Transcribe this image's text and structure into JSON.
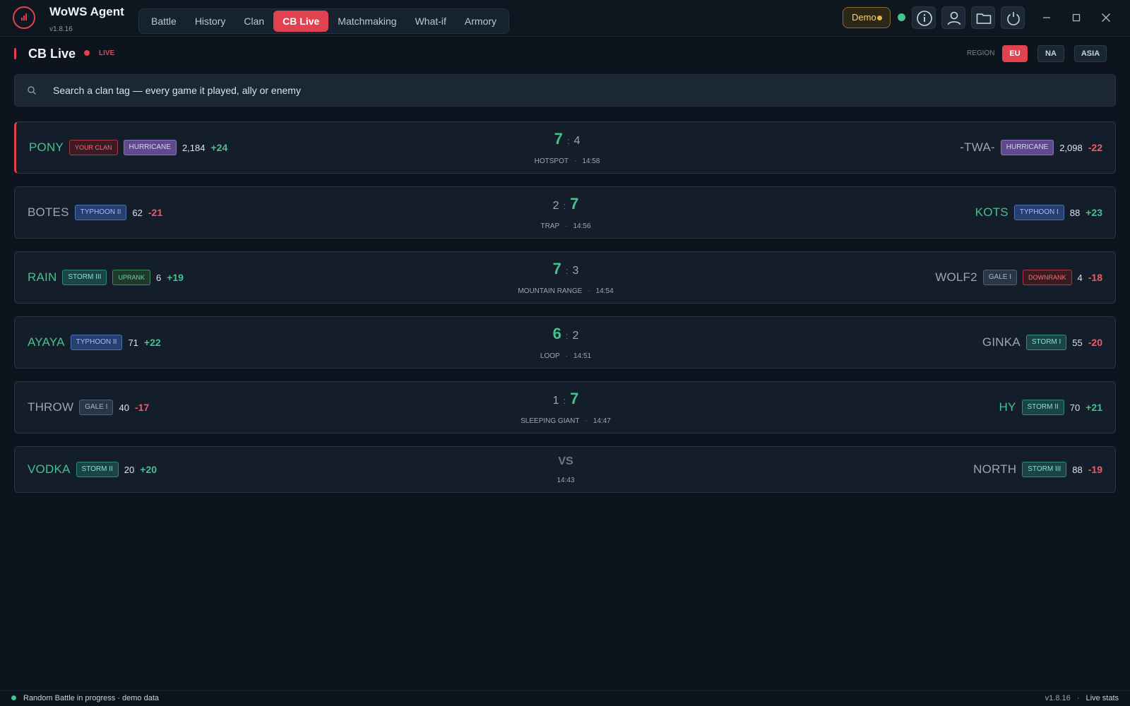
{
  "app": {
    "title": "WoWS Agent",
    "version": "v1.8.16"
  },
  "nav": {
    "tabs": [
      {
        "label": "Battle",
        "active": false
      },
      {
        "label": "History",
        "active": false
      },
      {
        "label": "Clan",
        "active": false
      },
      {
        "label": "CB Live",
        "active": true
      },
      {
        "label": "Matchmaking",
        "active": false
      },
      {
        "label": "What-if",
        "active": false
      },
      {
        "label": "Armory",
        "active": false
      }
    ]
  },
  "toolbar": {
    "demo_label": "Demo",
    "icons": [
      "info-icon",
      "user-icon",
      "folder-icon",
      "power-icon"
    ],
    "window_controls": [
      "minimize-icon",
      "maximize-icon",
      "close-icon"
    ]
  },
  "page": {
    "title": "CB Live",
    "live_label": "LIVE"
  },
  "region": {
    "label": "REGION",
    "options": [
      "EU",
      "NA",
      "ASIA"
    ],
    "selected": "EU"
  },
  "search": {
    "placeholder": "Search a clan tag — every game it played, ally or enemy",
    "value": ""
  },
  "battles": [
    {
      "left": {
        "tag": "PONY",
        "badges": [
          "YOUR CLAN",
          "HURRICANE"
        ],
        "rating": "2,184",
        "delta": "+24"
      },
      "score": {
        "left": "7",
        "right": "4"
      },
      "map": "HOTSPOT",
      "time": "14:58",
      "right": {
        "tag": "-TWA-",
        "badges": [
          "HURRICANE"
        ],
        "rating": "2,098",
        "delta": "-22"
      }
    },
    {
      "left": {
        "tag": "BOTES",
        "badges": [
          "TYPHOON II"
        ],
        "rating": "62",
        "delta": "-21"
      },
      "score": {
        "left": "2",
        "right": "7"
      },
      "map": "TRAP",
      "time": "14:56",
      "right": {
        "tag": "KOTS",
        "badges": [
          "TYPHOON I"
        ],
        "rating": "88",
        "delta": "+23"
      }
    },
    {
      "left": {
        "tag": "RAIN",
        "badges": [
          "STORM III",
          "UPRANK"
        ],
        "rating": "6",
        "delta": "+19"
      },
      "score": {
        "left": "7",
        "right": "3"
      },
      "map": "MOUNTAIN RANGE",
      "time": "14:54",
      "right": {
        "tag": "WOLF2",
        "badges": [
          "GALE I",
          "DOWNRANK"
        ],
        "rating": "4",
        "delta": "-18"
      }
    },
    {
      "left": {
        "tag": "AYAYA",
        "badges": [
          "TYPHOON II"
        ],
        "rating": "71",
        "delta": "+22"
      },
      "score": {
        "left": "6",
        "right": "2"
      },
      "map": "LOOP",
      "time": "14:51",
      "right": {
        "tag": "GINKA",
        "badges": [
          "STORM I"
        ],
        "rating": "55",
        "delta": "-20"
      }
    },
    {
      "left": {
        "tag": "THROW",
        "badges": [
          "GALE I"
        ],
        "rating": "40",
        "delta": "-17"
      },
      "score": {
        "left": "1",
        "right": "7"
      },
      "map": "SLEEPING GIANT",
      "time": "14:47",
      "right": {
        "tag": "HY",
        "badges": [
          "STORM II"
        ],
        "rating": "70",
        "delta": "+21"
      }
    },
    {
      "left": {
        "tag": "VODKA",
        "badges": [
          "STORM II"
        ],
        "rating": "20",
        "delta": "+20"
      },
      "vs": "VS",
      "time": "14:43",
      "right": {
        "tag": "NORTH",
        "badges": [
          "STORM III"
        ],
        "rating": "88",
        "delta": "-19"
      }
    }
  ],
  "status": {
    "text": "Random Battle in progress · demo data",
    "version": "v1.8.16",
    "sep": "·",
    "link": "Live stats"
  },
  "colors": {
    "accent": "#e0424f",
    "win": "#47c08d",
    "loss": "#ef5a66",
    "background": "#0d141d"
  }
}
